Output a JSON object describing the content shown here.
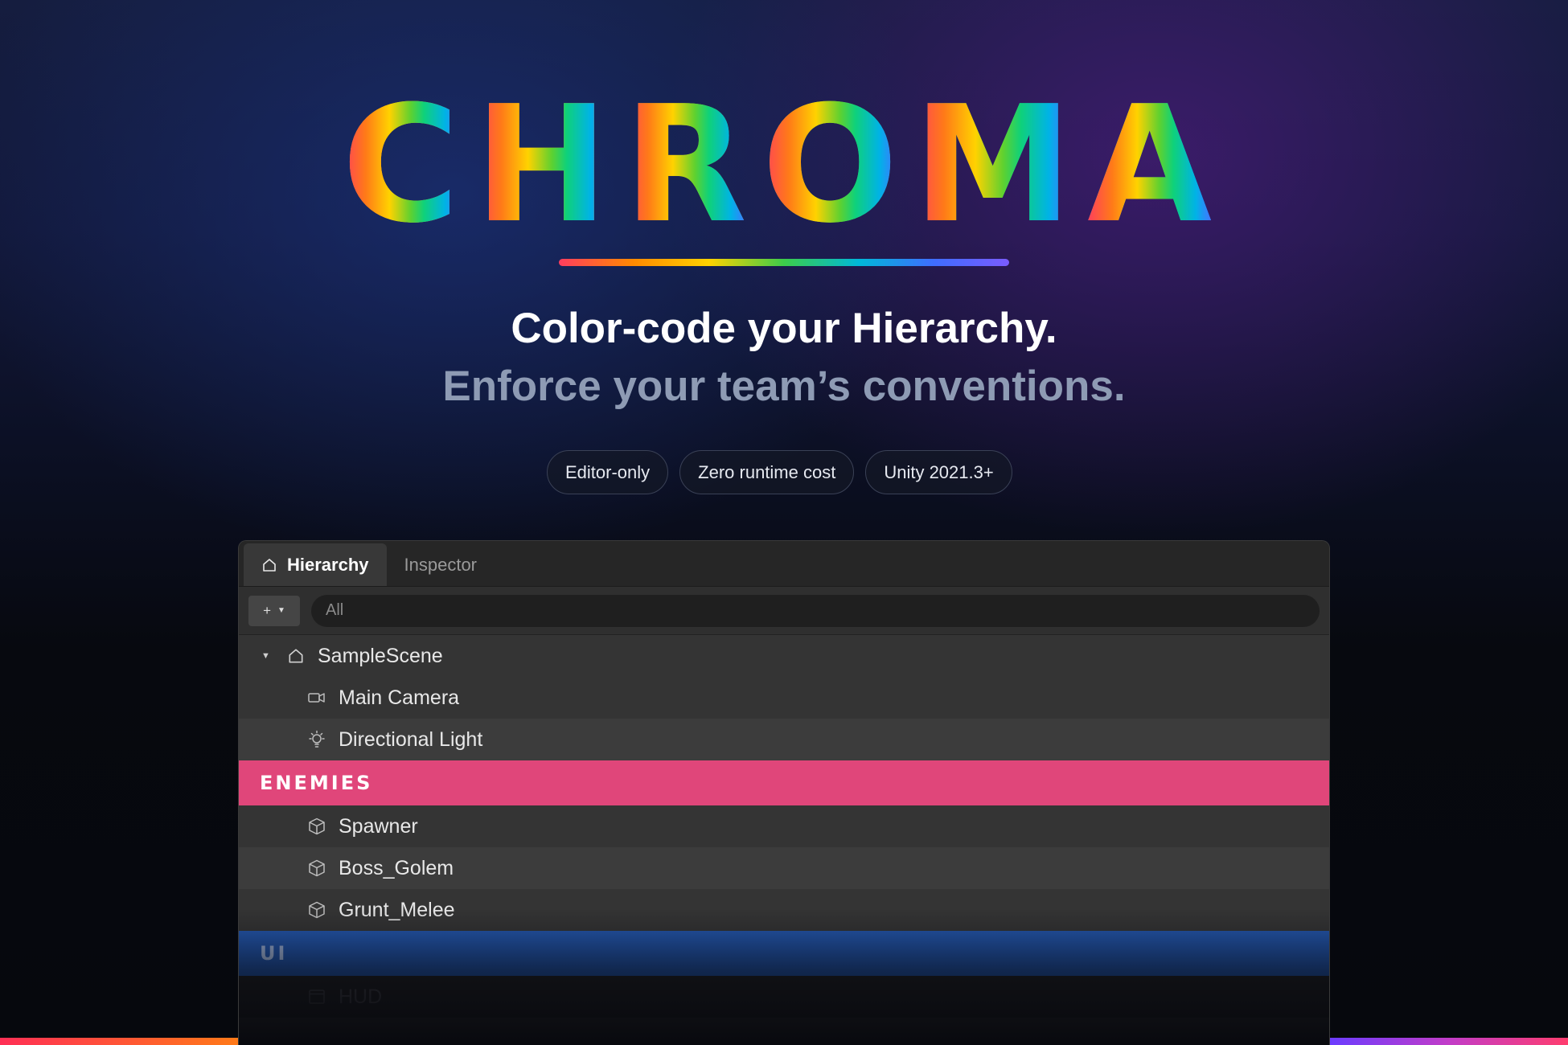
{
  "hero": {
    "logo_letters": [
      "C",
      "H",
      "R",
      "O",
      "M",
      "A"
    ],
    "tagline_primary": "Color-code your Hierarchy.",
    "tagline_secondary": "Enforce your team’s conventions.",
    "badges": [
      "Editor-only",
      "Zero runtime cost",
      "Unity 2021.3+"
    ]
  },
  "window": {
    "tabs": [
      {
        "label": "Hierarchy",
        "icon": "home-icon",
        "active": true
      },
      {
        "label": "Inspector",
        "active": false
      }
    ],
    "toolbar": {
      "add_label": "+",
      "add_caret": "▼",
      "search_placeholder": "All"
    },
    "scene": {
      "label": "SampleScene",
      "icon": "home-icon",
      "expand_glyph": "▼"
    },
    "items": [
      {
        "label": "Main Camera",
        "icon": "camera-icon"
      },
      {
        "label": "Directional Light",
        "icon": "light-bulb-icon"
      }
    ],
    "groups": [
      {
        "header": "ENEMIES",
        "color": "#e0467a",
        "items": [
          {
            "label": "Spawner",
            "icon": "cube-icon"
          },
          {
            "label": "Boss_Golem",
            "icon": "cube-icon"
          },
          {
            "label": "Grunt_Melee",
            "icon": "cube-icon"
          }
        ]
      },
      {
        "header": "UI",
        "color": "#1f52a8",
        "items": [
          {
            "label": "HUD",
            "icon": "window-icon"
          }
        ]
      }
    ]
  },
  "colors": {
    "accent_pink": "#e0467a",
    "accent_blue": "#1f52a8"
  }
}
